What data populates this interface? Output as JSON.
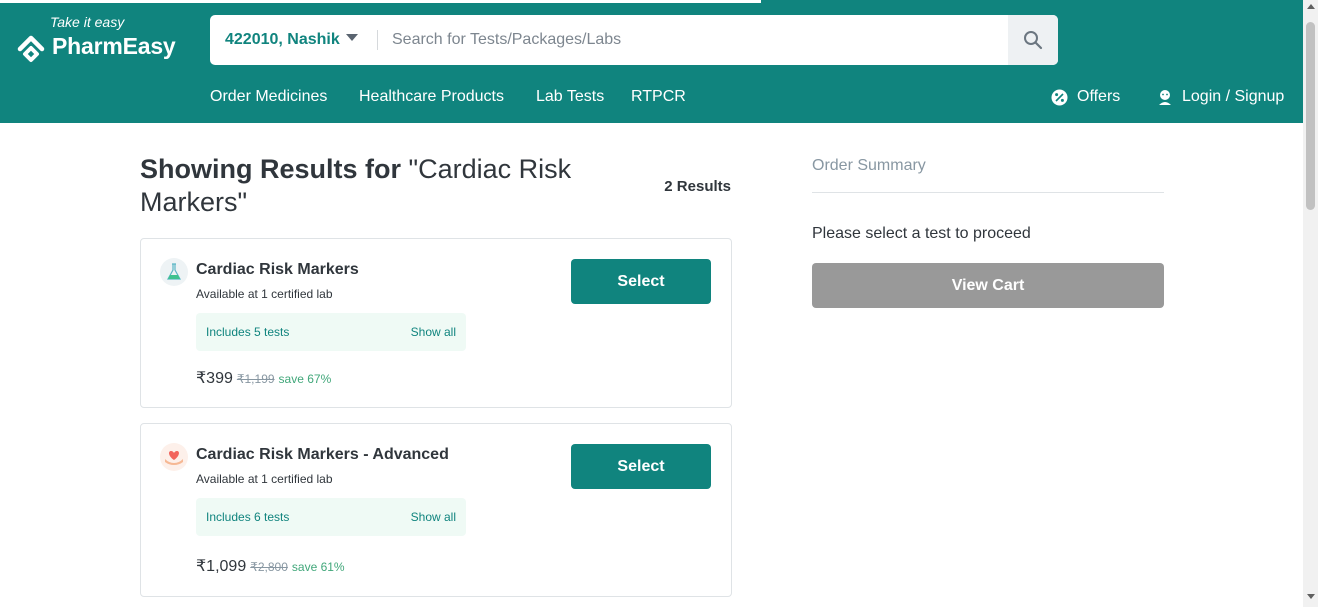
{
  "header": {
    "tagline": "Take it easy",
    "brand": "PharmEasy",
    "location": "422010, Nashik",
    "search_placeholder": "Search for Tests/Packages/Labs",
    "nav": [
      "Order Medicines",
      "Healthcare Products",
      "Lab Tests",
      "RTPCR"
    ],
    "offers": "Offers",
    "login": "Login / Signup"
  },
  "results": {
    "title_prefix": "Showing Results for",
    "query": "\"Cardiac Risk Markers\"",
    "count": "2 Results",
    "items": [
      {
        "name": "Cardiac Risk Markers",
        "availability": "Available at 1 certified lab",
        "includes": "Includes 5 tests",
        "show_all": "Show all",
        "price": "₹399",
        "mrp": "₹1,199",
        "save": "save 67%",
        "select": "Select"
      },
      {
        "name": "Cardiac Risk Markers - Advanced",
        "availability": "Available at 1 certified lab",
        "includes": "Includes 6 tests",
        "show_all": "Show all",
        "price": "₹1,099",
        "mrp": "₹2,800",
        "save": "save 61%",
        "select": "Select"
      }
    ]
  },
  "order_summary": {
    "title": "Order Summary",
    "message": "Please select a test to proceed",
    "view_cart": "View Cart"
  },
  "colors": {
    "brand": "#10847e",
    "save": "#41a77a",
    "disabled_button": "#999999",
    "tests_bg": "#effaf5"
  },
  "icons": [
    "pharmeasy-logo-icon",
    "chevron-down-icon",
    "search-icon",
    "offers-icon",
    "user-icon",
    "flask-icon",
    "heart-hands-icon"
  ]
}
